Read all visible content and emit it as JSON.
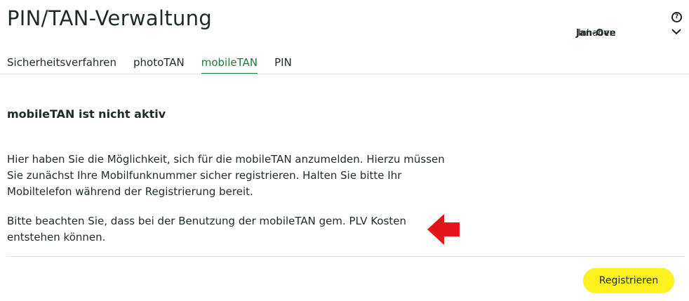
{
  "page": {
    "title": "PIN/TAN-Verwaltung"
  },
  "header": {
    "owner_label": "Inhaber:",
    "owner_name": "Jan-Ove"
  },
  "tabs": [
    {
      "label": "Sicherheitsverfahren",
      "active": false
    },
    {
      "label": "photoTAN",
      "active": false
    },
    {
      "label": "mobileTAN",
      "active": true
    },
    {
      "label": "PIN",
      "active": false
    }
  ],
  "content": {
    "heading": "mobileTAN ist nicht aktiv",
    "paragraph1_line1": "Hier haben Sie die Möglichkeit, sich für die mobileTAN anzumelden. Hierzu müssen",
    "paragraph1_line2": "Sie zunächst Ihre Mobilfunknummer sicher registrieren. Halten Sie bitte Ihr",
    "paragraph1_line3": "Mobiltelefon während der Registrierung bereit.",
    "paragraph2_line1": "Bitte beachten Sie, dass bei der Benutzung der mobileTAN gem. PLV Kosten",
    "paragraph2_line2": "entstehen können."
  },
  "actions": {
    "register_label": "Registrieren"
  },
  "colors": {
    "accent_green": "#1b7a3a",
    "button_yellow": "#fff11d",
    "annotation_red": "#e3141c"
  },
  "icons": {
    "help": "question-circle-icon",
    "expand": "chevron-down-icon",
    "annotation": "arrow-left-icon"
  }
}
